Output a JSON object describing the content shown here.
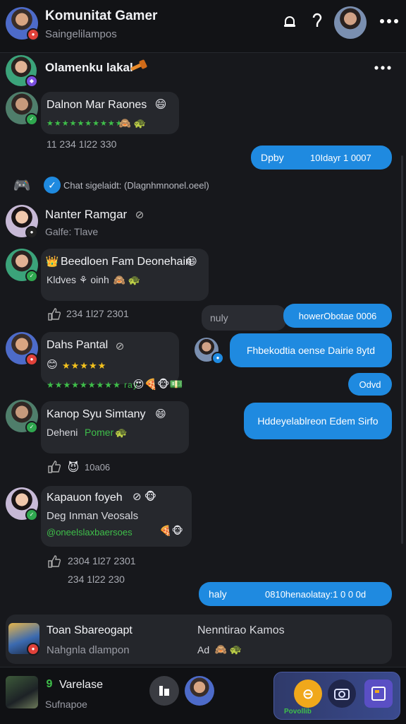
{
  "header": {
    "title": "Komunitat Gamer",
    "subtitle": "Saingelilampos"
  },
  "pinned": {
    "name": "Olamenku lakal"
  },
  "messages": [
    {
      "name": "Dalnon Mar Raones",
      "stars": "★★★★★★★★★★",
      "meta": "11   234   1l22   330"
    },
    {
      "text": "Chat sigelaidt:  (Dlagnhmnonel.oeel)"
    },
    {
      "name": "Nanter Ramgar",
      "sub": "Galfe: Tlave"
    },
    {
      "name": "Beedloen Fam Deonehain",
      "body": "Kldves ⚘ oinh",
      "meta": "234   1l27   2301"
    },
    {
      "name": "Dahs Pantal",
      "body": "★★★★★",
      "line2": "★★★★★★★★★ ray",
      "meta": ""
    },
    {
      "name": "Kanop Syu Simtany",
      "body": "Deheni",
      "body2": "Pomer",
      "meta": "10a06"
    },
    {
      "name": "Kapauon foyeh",
      "body": "Deg Inman Veosals",
      "body2": "@oneelslaxbaersoes",
      "meta": "2304   1l27   2301",
      "meta2": "234   1l22   230"
    }
  ],
  "outgoing": [
    {
      "label": "Dpby",
      "text": "10Idayr 1 0007"
    },
    {
      "label": "nuly",
      "text": "howerObotae 0006"
    },
    {
      "text": "Fhbekodtia oense Dairie 8ytd"
    },
    {
      "text": "Odvd"
    },
    {
      "text": "Hddeyelablreon Edem Sirfo"
    },
    {
      "label": "haly",
      "text": "0810henaolatay:1 0 0 0d"
    }
  ],
  "ad": {
    "name": "Toan Sbareogapt",
    "sub": "Nahgnla dlampon",
    "right_title": "Nenntirao Kamos",
    "right_sub": "Ad"
  },
  "footer": {
    "name": "Varelase",
    "sub": "Sufnapoe",
    "tab_label": "Povollib"
  },
  "colors": {
    "accent": "#1f8ae0",
    "background": "#17181c",
    "green": "#3fbf4a"
  }
}
